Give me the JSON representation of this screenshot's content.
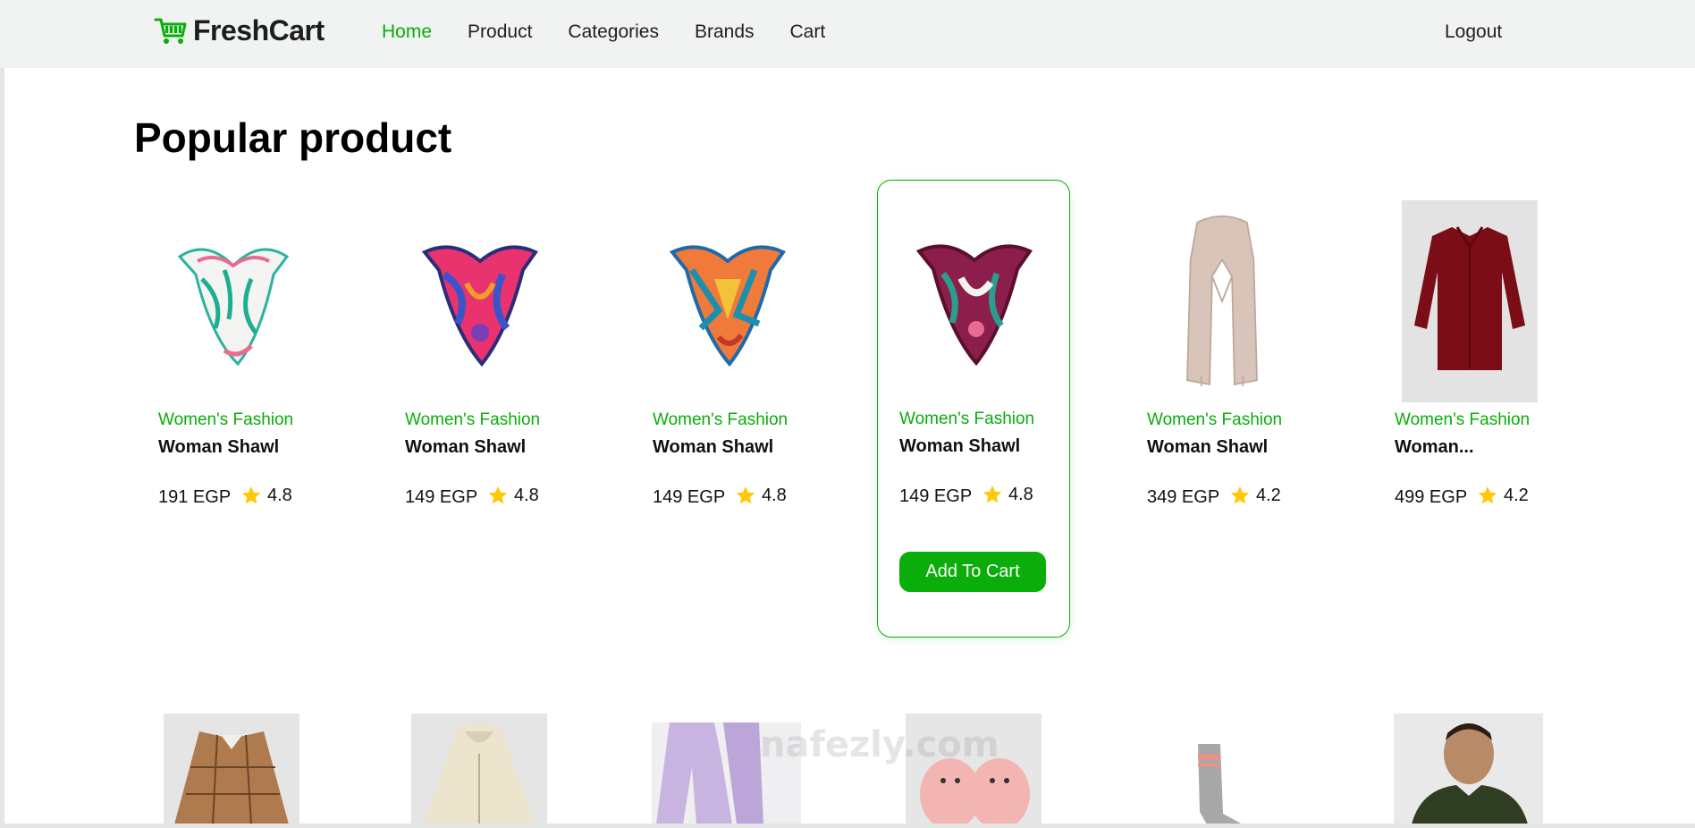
{
  "brand": {
    "name": "FreshCart",
    "accent": "#0aad0a"
  },
  "nav": {
    "links": [
      "Home",
      "Product",
      "Categories",
      "Brands",
      "Cart"
    ],
    "active": "Home",
    "logout": "Logout"
  },
  "page": {
    "title": "Popular product"
  },
  "product_card": {
    "add_to_cart_label": "Add To Cart"
  },
  "products": [
    {
      "category": "Women's Fashion",
      "name": "Woman Shawl",
      "price": "191 EGP",
      "rating": "4.8",
      "image": "white-green-silk-scarf"
    },
    {
      "category": "Women's Fashion",
      "name": "Woman Shawl",
      "price": "149 EGP",
      "rating": "4.8",
      "image": "pink-blue-silk-scarf"
    },
    {
      "category": "Women's Fashion",
      "name": "Woman Shawl",
      "price": "149 EGP",
      "rating": "4.8",
      "image": "orange-blue-silk-scarf"
    },
    {
      "category": "Women's Fashion",
      "name": "Woman Shawl",
      "price": "149 EGP",
      "rating": "4.8",
      "image": "burgundy-floral-silk-scarf"
    },
    {
      "category": "Women's Fashion",
      "name": "Woman Shawl",
      "price": "349 EGP",
      "rating": "4.2",
      "image": "beige-long-scarf"
    },
    {
      "category": "Women's Fashion",
      "name": "Woman...",
      "price": "499 EGP",
      "rating": "4.2",
      "image": "burgundy-shirt"
    }
  ],
  "next_row_images": [
    "plaid-shirt",
    "cream-hoodie",
    "lilac-joggers",
    "pink-slippers",
    "grey-sock",
    "green-tshirt-man"
  ],
  "watermark": "nafezly.com"
}
